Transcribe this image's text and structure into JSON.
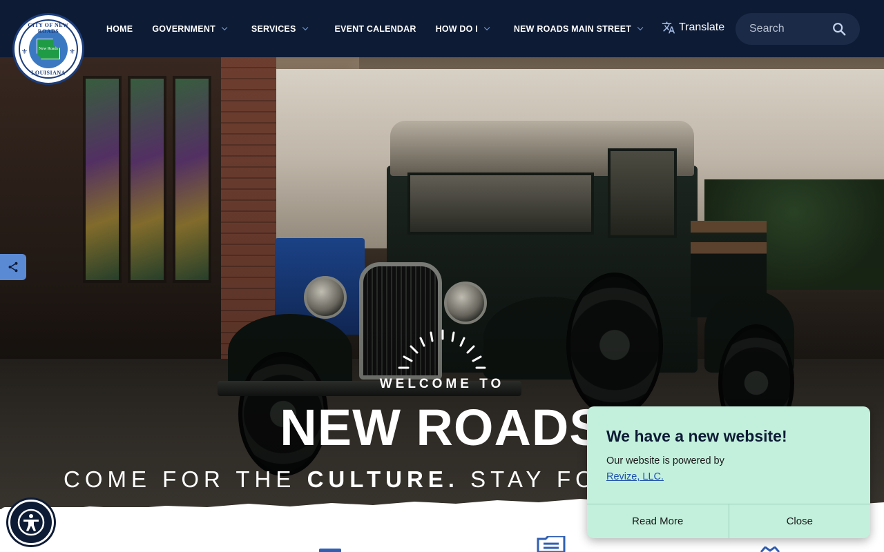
{
  "header": {
    "logo": {
      "top_text": "CITY OF NEW ROADS",
      "bottom_text": "LOUISIANA",
      "center_text": "New Roads",
      "icon": "city-seal-logo"
    },
    "nav": [
      {
        "label": "HOME",
        "has_dropdown": false
      },
      {
        "label": "GOVERNMENT",
        "has_dropdown": true
      },
      {
        "label": "SERVICES",
        "has_dropdown": true
      },
      {
        "label": "EVENT CALENDAR",
        "has_dropdown": false
      },
      {
        "label": "HOW DO I",
        "has_dropdown": true
      },
      {
        "label": "NEW ROADS MAIN STREET",
        "has_dropdown": true
      }
    ],
    "translate_label": "Translate",
    "search_placeholder": "Search"
  },
  "hero": {
    "welcome": "WELCOME TO",
    "title": "NEW ROADS",
    "tagline_pre": "COME FOR THE",
    "tagline_bold": "CULTURE.",
    "tagline_post": "STAY FOR"
  },
  "popup": {
    "title": "We have a new website!",
    "text": "Our website is powered by",
    "link": "Revize, LLC.",
    "read_more": "Read More",
    "close": "Close"
  },
  "colors": {
    "header_bg": "#0d1b35",
    "accent_blue": "#5b8ad4",
    "popup_bg": "#c3f0dc",
    "link": "#1c4fae"
  }
}
